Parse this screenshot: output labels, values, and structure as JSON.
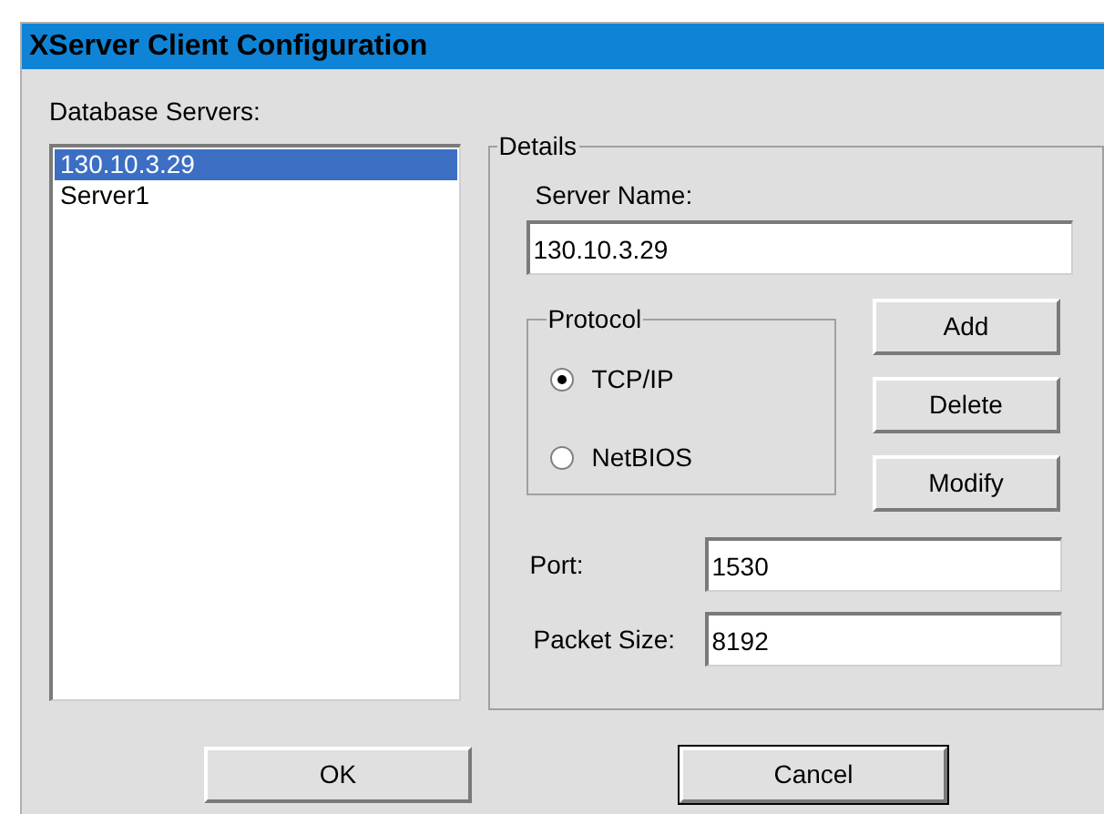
{
  "window": {
    "title": "XServer Client Configuration"
  },
  "servers": {
    "label": "Database Servers:",
    "items": [
      {
        "name": "130.10.3.29",
        "selected": true
      },
      {
        "name": "Server1",
        "selected": false
      }
    ]
  },
  "details": {
    "title": "Details",
    "server_name": {
      "label": "Server Name:",
      "value": "130.10.3.29"
    },
    "protocol": {
      "title": "Protocol",
      "options": [
        {
          "label": "TCP/IP",
          "selected": true
        },
        {
          "label": "NetBIOS",
          "selected": false
        }
      ]
    },
    "buttons": [
      "Add",
      "Delete",
      "Modify"
    ],
    "port": {
      "label": "Port:",
      "value": "1530"
    },
    "packet_size": {
      "label": "Packet Size:",
      "value": "8192"
    }
  },
  "buttons": [
    {
      "label": "OK",
      "default": false
    },
    {
      "label": "Cancel",
      "default": true
    }
  ]
}
